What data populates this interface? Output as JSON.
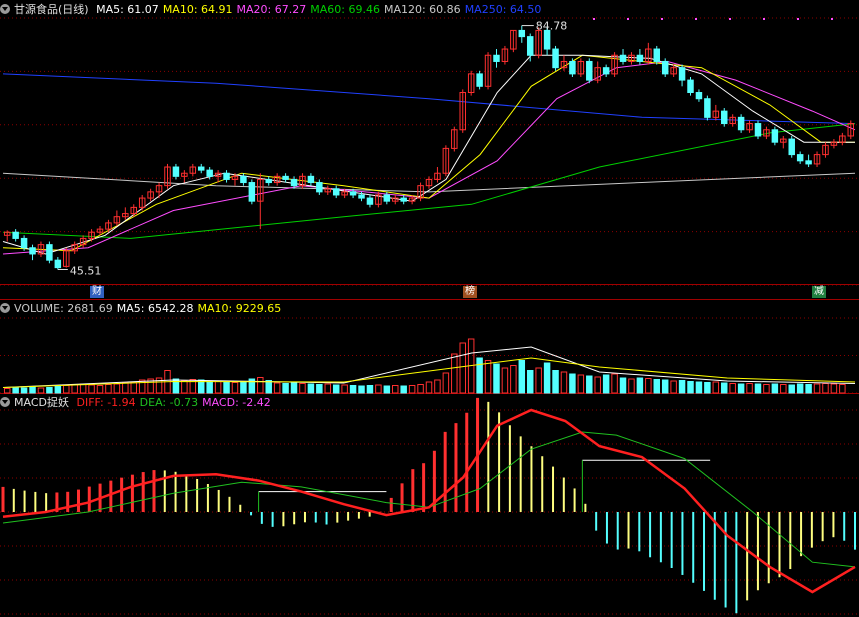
{
  "colors": {
    "up": "#ff3030",
    "down": "#54ffff",
    "ma5": "#ffffff",
    "ma10": "#ffff00",
    "ma20": "#ff4dff",
    "ma60": "#00d000",
    "ma120": "#c8c8c8",
    "ma250": "#2040ff",
    "diff": "#ff2020",
    "dea": "#20c020",
    "grid": "#8b0000"
  },
  "price_header": {
    "title": "甘源食品(日线)",
    "items": [
      {
        "label": "MA5: 61.07",
        "color": "#ffffff"
      },
      {
        "label": "MA10: 64.91",
        "color": "#ffff00"
      },
      {
        "label": "MA20: 67.27",
        "color": "#ff4dff"
      },
      {
        "label": "MA60: 69.46",
        "color": "#00d000"
      },
      {
        "label": "MA120: 60.86",
        "color": "#c8c8c8"
      },
      {
        "label": "MA250: 64.50",
        "color": "#2040ff"
      }
    ]
  },
  "volume_header": {
    "items": [
      {
        "label": "VOLUME: 2681.69",
        "color": "#c8c8c8"
      },
      {
        "label": "MA5: 6542.28",
        "color": "#ffffff"
      },
      {
        "label": "MA10: 9229.65",
        "color": "#ffff00"
      }
    ]
  },
  "macd_header": {
    "title": "MACD捉妖",
    "items": [
      {
        "label": "DIFF: -1.94",
        "color": "#ff2020"
      },
      {
        "label": "DEA: -0.73",
        "color": "#20c020"
      },
      {
        "label": "MACD: -2.42",
        "color": "#ff4dff"
      }
    ]
  },
  "tags": [
    {
      "text": "财",
      "color": "#3060c0"
    },
    {
      "text": "榜",
      "color": "#a05020"
    },
    {
      "text": "减",
      "color": "#208040"
    }
  ],
  "chart_data": {
    "type": "candlestick",
    "ylim": [
      43,
      86
    ],
    "max_label": "84.78",
    "min_label": "45.51",
    "candles": [
      [
        51,
        51.5,
        50,
        51.8
      ],
      [
        51.5,
        50.5,
        50,
        52
      ],
      [
        50.5,
        49,
        48.5,
        51
      ],
      [
        49,
        48,
        47,
        49.5
      ],
      [
        48,
        49.5,
        47.5,
        50
      ],
      [
        49.5,
        47,
        46.5,
        50
      ],
      [
        47,
        45.8,
        45.5,
        47.5
      ],
      [
        46,
        48.5,
        45.8,
        49
      ],
      [
        48.5,
        49.5,
        48,
        50
      ],
      [
        49.5,
        50.5,
        49,
        51
      ],
      [
        50.5,
        51.5,
        50,
        52
      ],
      [
        51.5,
        52,
        51,
        52.5
      ],
      [
        52,
        53,
        51.5,
        53.5
      ],
      [
        53,
        54,
        52.5,
        55
      ],
      [
        54,
        54.5,
        53.5,
        55.5
      ],
      [
        54.5,
        55.5,
        54,
        56
      ],
      [
        55.5,
        57,
        55,
        57.5
      ],
      [
        57,
        58,
        56.5,
        58.5
      ],
      [
        58,
        59,
        57,
        59.5
      ],
      [
        59,
        62,
        58.5,
        62.5
      ],
      [
        62,
        60.5,
        60,
        62.5
      ],
      [
        60.5,
        61,
        59.5,
        61.5
      ],
      [
        61,
        62,
        60.5,
        62.5
      ],
      [
        62,
        61.5,
        61,
        62.5
      ],
      [
        61.5,
        60.5,
        60,
        62
      ],
      [
        60.5,
        61,
        59.5,
        61.5
      ],
      [
        61,
        60,
        59.5,
        61.5
      ],
      [
        60,
        60.5,
        59,
        61
      ],
      [
        60.5,
        59.5,
        59,
        61
      ],
      [
        59.5,
        56.5,
        56,
        60
      ],
      [
        56.5,
        60,
        52,
        61
      ],
      [
        60,
        59.5,
        59,
        60.5
      ],
      [
        59.5,
        60.5,
        59,
        61
      ],
      [
        60.5,
        60,
        59.5,
        61
      ],
      [
        60,
        59,
        58.5,
        60.5
      ],
      [
        59,
        60.5,
        58.5,
        61
      ],
      [
        60.5,
        59.5,
        59,
        61
      ],
      [
        59.5,
        58,
        57.5,
        60
      ],
      [
        58,
        58.5,
        57.5,
        59
      ],
      [
        58.5,
        57.5,
        57,
        59
      ],
      [
        57.5,
        58,
        57,
        58.5
      ],
      [
        58,
        57.5,
        57,
        58.5
      ],
      [
        57.5,
        57,
        56.5,
        58
      ],
      [
        57,
        56,
        55.5,
        57.5
      ],
      [
        56,
        57.5,
        55.5,
        58
      ],
      [
        57.5,
        56.5,
        56,
        58
      ],
      [
        56.5,
        57,
        56,
        57.5
      ],
      [
        57,
        56.5,
        56,
        57.5
      ],
      [
        56.5,
        57,
        56,
        57.5
      ],
      [
        57,
        59,
        56.5,
        59.5
      ],
      [
        59,
        60,
        58.5,
        60.5
      ],
      [
        60,
        61,
        59.5,
        62
      ],
      [
        61,
        65,
        60.5,
        65.5
      ],
      [
        65,
        68,
        64.5,
        68.5
      ],
      [
        68,
        74,
        67.5,
        74.5
      ],
      [
        74,
        77,
        73.5,
        77.5
      ],
      [
        77,
        75,
        74.5,
        77.5
      ],
      [
        75,
        80,
        74.5,
        80.5
      ],
      [
        80,
        79,
        78,
        81
      ],
      [
        79,
        81,
        78.5,
        81.5
      ],
      [
        81,
        84,
        80.5,
        84
      ],
      [
        84,
        83,
        82,
        84.78
      ],
      [
        83,
        80,
        79,
        83.5
      ],
      [
        80,
        84,
        79.5,
        84.5
      ],
      [
        84,
        81,
        80,
        84.5
      ],
      [
        81,
        78,
        77.5,
        81.5
      ],
      [
        78,
        79,
        77.5,
        80
      ],
      [
        79,
        77,
        76.5,
        79.5
      ],
      [
        77,
        79,
        76.5,
        79.5
      ],
      [
        79,
        76,
        75.5,
        79.5
      ],
      [
        76,
        78,
        75.5,
        79
      ],
      [
        78,
        77,
        76.5,
        78.5
      ],
      [
        77,
        80,
        76.5,
        80.5
      ],
      [
        80,
        79,
        78.5,
        81
      ],
      [
        79,
        80,
        78.5,
        80.5
      ],
      [
        80,
        79,
        78.5,
        81
      ],
      [
        79,
        81,
        78.5,
        82
      ],
      [
        81,
        79,
        78.5,
        81.5
      ],
      [
        79,
        77,
        76.5,
        79.5
      ],
      [
        77,
        78,
        76.5,
        78.5
      ],
      [
        78,
        76,
        75,
        78.5
      ],
      [
        76,
        74,
        73.5,
        76.5
      ],
      [
        74,
        73,
        72.5,
        74.5
      ],
      [
        73,
        70,
        69.5,
        73.5
      ],
      [
        70,
        71,
        69.5,
        72
      ],
      [
        71,
        69,
        68.5,
        71.5
      ],
      [
        69,
        70,
        68.5,
        70.5
      ],
      [
        70,
        68,
        67.5,
        70.5
      ],
      [
        68,
        69,
        67.5,
        69.5
      ],
      [
        69,
        67,
        66.5,
        69.5
      ],
      [
        67,
        68,
        66.5,
        68.5
      ],
      [
        68,
        66,
        65.5,
        68.5
      ],
      [
        66,
        66.5,
        65,
        67
      ],
      [
        66.5,
        64,
        63.5,
        67
      ],
      [
        64,
        63,
        62.5,
        64.5
      ],
      [
        63,
        62.5,
        62,
        64
      ],
      [
        62.5,
        64,
        62,
        64.5
      ],
      [
        64,
        65.5,
        63.5,
        66
      ],
      [
        65.5,
        66,
        65,
        66.5
      ],
      [
        66,
        67,
        65.5,
        67.5
      ],
      [
        67,
        69,
        66.5,
        69.5
      ]
    ],
    "ma_series": [
      {
        "name": "MA250",
        "color": "#2040ff",
        "points": [
          [
            0,
            77
          ],
          [
            25,
            75.5
          ],
          [
            50,
            73
          ],
          [
            75,
            70
          ],
          [
            100,
            69
          ]
        ]
      },
      {
        "name": "MA120",
        "color": "#c8c8c8",
        "points": [
          [
            0,
            61
          ],
          [
            25,
            59
          ],
          [
            50,
            58
          ],
          [
            75,
            59.5
          ],
          [
            100,
            61
          ]
        ]
      },
      {
        "name": "MA60",
        "color": "#00d000",
        "points": [
          [
            0,
            51.5
          ],
          [
            15,
            50.5
          ],
          [
            40,
            54
          ],
          [
            55,
            56
          ],
          [
            70,
            62
          ],
          [
            90,
            67.5
          ],
          [
            100,
            69
          ]
        ]
      },
      {
        "name": "MA20",
        "color": "#ff4dff",
        "points": [
          [
            0,
            48
          ],
          [
            10,
            49
          ],
          [
            20,
            55
          ],
          [
            35,
            59
          ],
          [
            50,
            57
          ],
          [
            58,
            63
          ],
          [
            65,
            73
          ],
          [
            72,
            78
          ],
          [
            78,
            79
          ],
          [
            86,
            76
          ],
          [
            95,
            71
          ],
          [
            100,
            68
          ]
        ]
      },
      {
        "name": "MA10",
        "color": "#ffff00",
        "points": [
          [
            0,
            49
          ],
          [
            8,
            48.5
          ],
          [
            18,
            56
          ],
          [
            28,
            61
          ],
          [
            40,
            59
          ],
          [
            50,
            57
          ],
          [
            56,
            64
          ],
          [
            62,
            75
          ],
          [
            68,
            80
          ],
          [
            75,
            79
          ],
          [
            82,
            78
          ],
          [
            90,
            72
          ],
          [
            96,
            66
          ],
          [
            100,
            66
          ]
        ]
      },
      {
        "name": "MA5",
        "color": "#ffffff",
        "points": [
          [
            0,
            50
          ],
          [
            5,
            48
          ],
          [
            12,
            51
          ],
          [
            20,
            59
          ],
          [
            26,
            61
          ],
          [
            36,
            59
          ],
          [
            48,
            56.5
          ],
          [
            52,
            60
          ],
          [
            58,
            74
          ],
          [
            62,
            80
          ],
          [
            68,
            80
          ],
          [
            76,
            79.5
          ],
          [
            82,
            77
          ],
          [
            88,
            71
          ],
          [
            94,
            66
          ],
          [
            100,
            66
          ]
        ]
      }
    ],
    "volume": {
      "ylim": [
        0,
        15000
      ],
      "values": [
        900,
        1100,
        1000,
        1200,
        1000,
        1100,
        1300,
        1500,
        1700,
        1800,
        1600,
        1500,
        1700,
        1800,
        2000,
        2200,
        2600,
        2800,
        3000,
        4500,
        2800,
        2500,
        2700,
        2600,
        2300,
        2400,
        2200,
        2100,
        2300,
        2800,
        3100,
        2500,
        2000,
        1900,
        2100,
        1900,
        1800,
        1700,
        1800,
        1600,
        1600,
        1500,
        1400,
        1500,
        1600,
        1400,
        1500,
        1400,
        1500,
        1700,
        2200,
        2600,
        4000,
        7800,
        10000,
        10800,
        7000,
        6500,
        5800,
        5000,
        5500,
        6500,
        4500,
        5000,
        6000,
        4500,
        4200,
        3800,
        3600,
        3400,
        3200,
        3600,
        3800,
        3000,
        2800,
        3000,
        2900,
        2700,
        2600,
        2400,
        2500,
        2300,
        2200,
        2100,
        2200,
        2000,
        1900,
        1800,
        1900,
        1800,
        1700,
        1800,
        1700,
        1600,
        1800,
        1700,
        1800,
        1900,
        1800,
        1700
      ],
      "ma5": [
        [
          0,
          1100
        ],
        [
          20,
          2600
        ],
        [
          40,
          2000
        ],
        [
          55,
          8000
        ],
        [
          62,
          9200
        ],
        [
          70,
          4200
        ],
        [
          85,
          2400
        ],
        [
          100,
          1900
        ]
      ],
      "ma10": [
        [
          0,
          1100
        ],
        [
          20,
          2300
        ],
        [
          40,
          2200
        ],
        [
          55,
          5500
        ],
        [
          62,
          7000
        ],
        [
          70,
          5200
        ],
        [
          85,
          3000
        ],
        [
          100,
          2200
        ]
      ]
    },
    "macd": {
      "ylim": [
        -6.5,
        6.5
      ],
      "diff": [
        [
          0,
          -0.3
        ],
        [
          5,
          0
        ],
        [
          10,
          0.6
        ],
        [
          15,
          1.6
        ],
        [
          20,
          2.3
        ],
        [
          25,
          2.4
        ],
        [
          30,
          2
        ],
        [
          35,
          1.3
        ],
        [
          40,
          0.5
        ],
        [
          45,
          -0.2
        ],
        [
          50,
          0.3
        ],
        [
          54,
          2.2
        ],
        [
          58,
          5.5
        ],
        [
          62,
          6.5
        ],
        [
          66,
          5.8
        ],
        [
          70,
          4.2
        ],
        [
          75,
          3.5
        ],
        [
          80,
          1.5
        ],
        [
          85,
          -1.5
        ],
        [
          90,
          -3.5
        ],
        [
          95,
          -5.1
        ],
        [
          100,
          -3.5
        ]
      ],
      "dea": [
        [
          0,
          -0.7
        ],
        [
          10,
          0
        ],
        [
          20,
          1.2
        ],
        [
          28,
          1.9
        ],
        [
          35,
          1.6
        ],
        [
          45,
          0.6
        ],
        [
          50,
          0.3
        ],
        [
          56,
          1.5
        ],
        [
          62,
          4
        ],
        [
          68,
          5.1
        ],
        [
          72,
          4.9
        ],
        [
          80,
          3.4
        ],
        [
          88,
          0
        ],
        [
          95,
          -3.2
        ],
        [
          100,
          -3.5
        ]
      ],
      "hist": [
        [
          0,
          1.6
        ],
        [
          2,
          1.4
        ],
        [
          5,
          1.2
        ],
        [
          8,
          1.3
        ],
        [
          10,
          1.6
        ],
        [
          12,
          1.9
        ],
        [
          14,
          2.2
        ],
        [
          16,
          2.5
        ],
        [
          18,
          2.7
        ],
        [
          20,
          2.6
        ],
        [
          22,
          2.3
        ],
        [
          24,
          1.8
        ],
        [
          26,
          1.2
        ],
        [
          28,
          0.4
        ],
        [
          30,
          -0.7
        ],
        [
          32,
          -1
        ],
        [
          34,
          -0.8
        ],
        [
          36,
          -0.6
        ],
        [
          38,
          -0.8
        ],
        [
          40,
          -0.6
        ],
        [
          42,
          -0.4
        ],
        [
          44,
          -0.2
        ],
        [
          46,
          1.2
        ],
        [
          48,
          2.7
        ],
        [
          50,
          3.3
        ],
        [
          52,
          5.2
        ],
        [
          54,
          6
        ],
        [
          56,
          7.5
        ],
        [
          58,
          6.5
        ],
        [
          60,
          5.2
        ],
        [
          62,
          4.2
        ],
        [
          64,
          3.2
        ],
        [
          66,
          2.1
        ],
        [
          68,
          1
        ],
        [
          70,
          -1.7
        ],
        [
          72,
          -2.4
        ],
        [
          74,
          -2.3
        ],
        [
          76,
          -2.9
        ],
        [
          78,
          -3.4
        ],
        [
          80,
          -4.1
        ],
        [
          82,
          -4.9
        ],
        [
          84,
          -5.8
        ],
        [
          86,
          -6.5
        ],
        [
          88,
          -5.2
        ],
        [
          90,
          -4.5
        ],
        [
          92,
          -3.9
        ],
        [
          94,
          -2.6
        ],
        [
          96,
          -1.9
        ],
        [
          98,
          -1.5
        ],
        [
          100,
          -2.4
        ]
      ],
      "ref_levels": [
        [
          30,
          45,
          1.3
        ],
        [
          68,
          83,
          3.3
        ]
      ]
    }
  }
}
